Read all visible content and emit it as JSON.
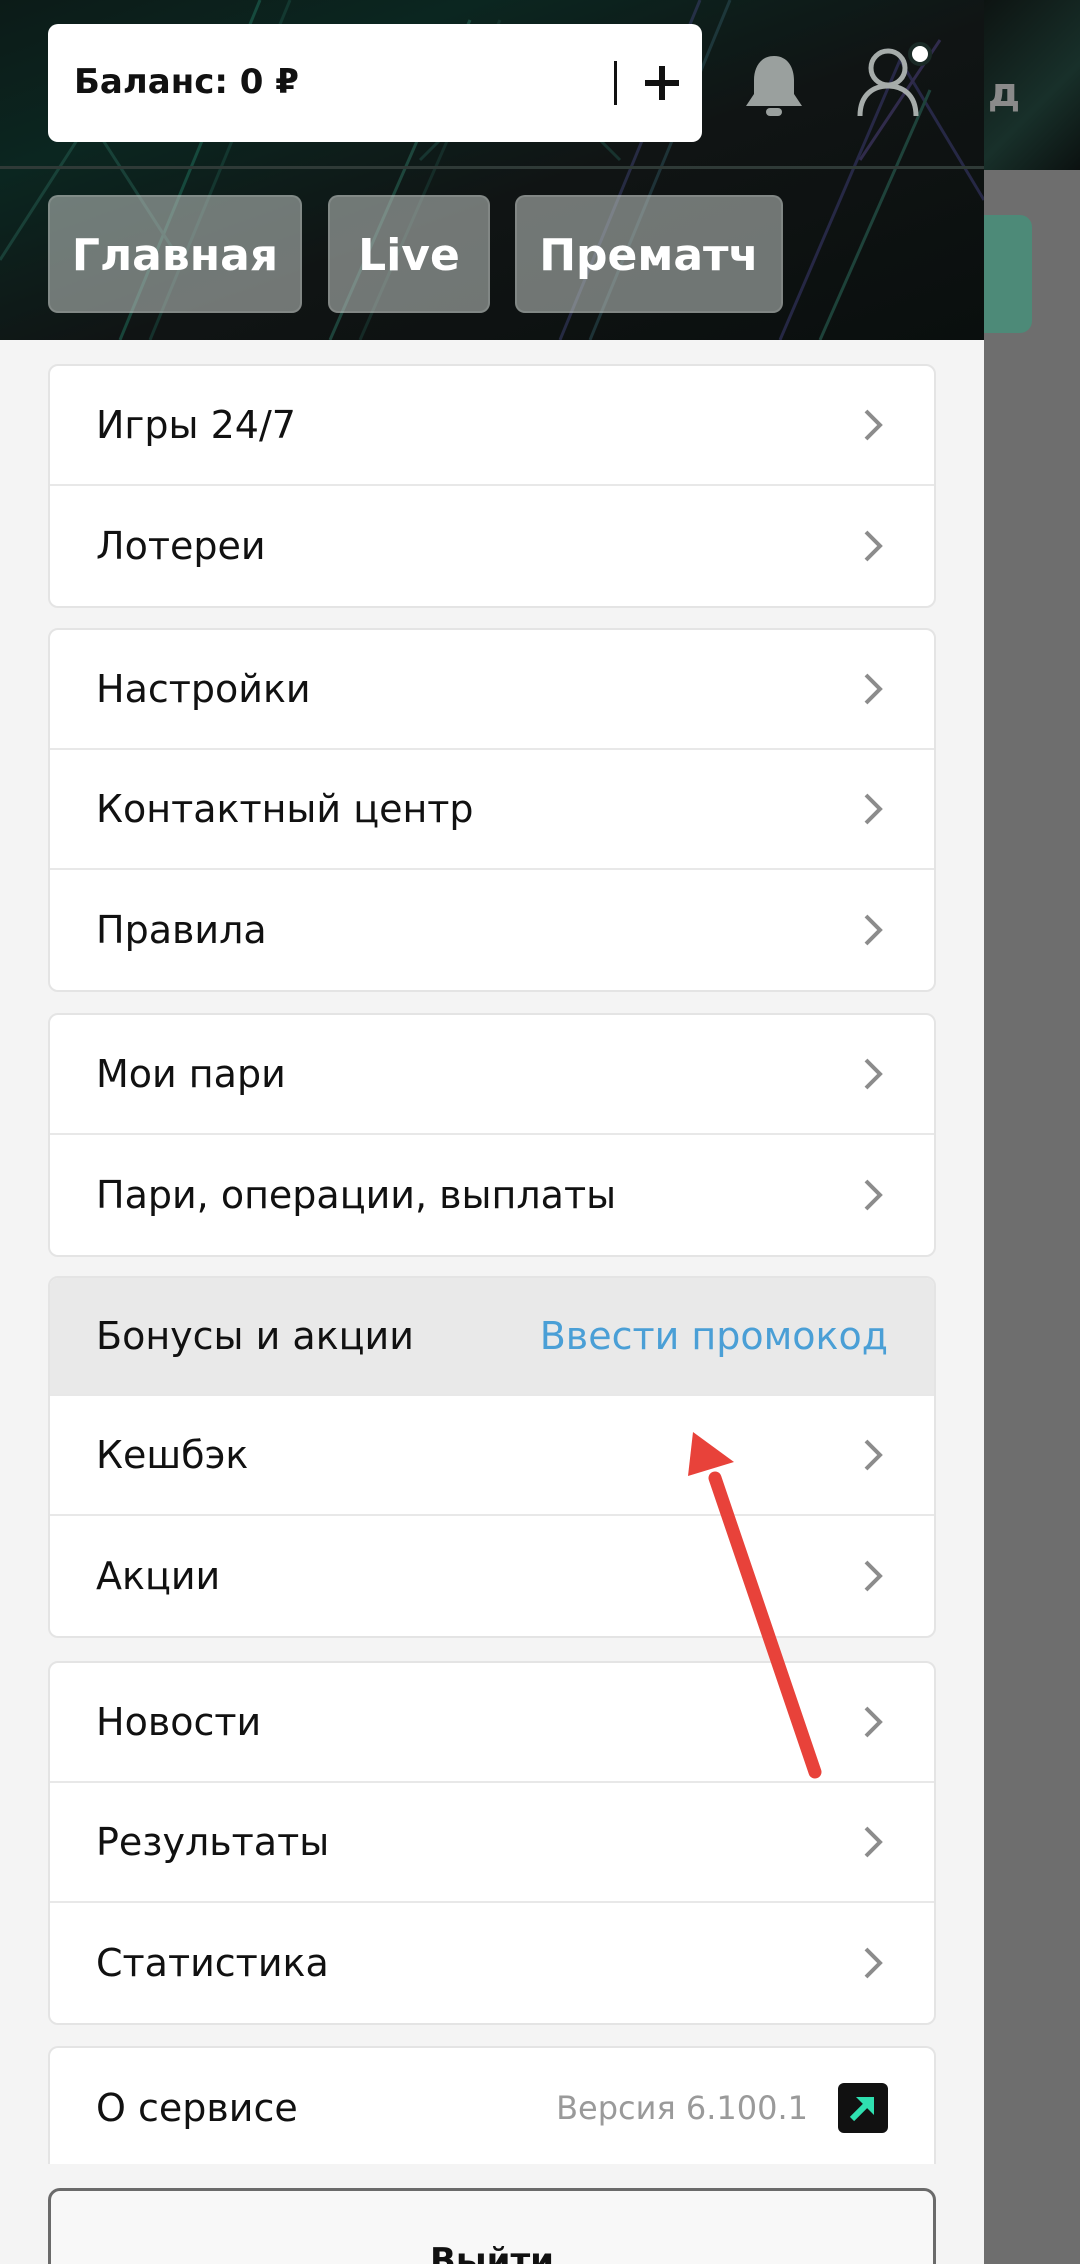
{
  "colors": {
    "accent_link": "#4a9fd6",
    "annotation_arrow": "#e8423a",
    "brand_dark": "#0b1715",
    "brand_teal": "#2fe0b0"
  },
  "header": {
    "balance_label": "Баланс: 0 ₽",
    "add_icon": "plus-icon",
    "notifications_icon": "bell-icon",
    "profile_icon": "user-icon",
    "tabs": [
      {
        "label": "Главная"
      },
      {
        "label": "Live"
      },
      {
        "label": "Прематч"
      }
    ]
  },
  "background_page": {
    "letter": "д"
  },
  "menu": {
    "group1": [
      {
        "label": "Игры 24/7"
      },
      {
        "label": "Лотереи"
      }
    ],
    "group2": [
      {
        "label": "Настройки"
      },
      {
        "label": "Контактный центр"
      },
      {
        "label": "Правила"
      }
    ],
    "group3": [
      {
        "label": "Мои пари"
      },
      {
        "label": "Пари, операции, выплаты"
      }
    ],
    "bonuses": {
      "title": "Бонусы и акции",
      "promo_link": "Ввести промокод",
      "items": [
        {
          "label": "Кешбэк"
        },
        {
          "label": "Акции"
        }
      ]
    },
    "group5": [
      {
        "label": "Новости"
      },
      {
        "label": "Результаты"
      },
      {
        "label": "Статистика"
      }
    ],
    "about": {
      "label": "О сервисе",
      "version": "Версия 6.100.1",
      "icon": "external-link-icon"
    }
  },
  "logout_label": "Выйти"
}
